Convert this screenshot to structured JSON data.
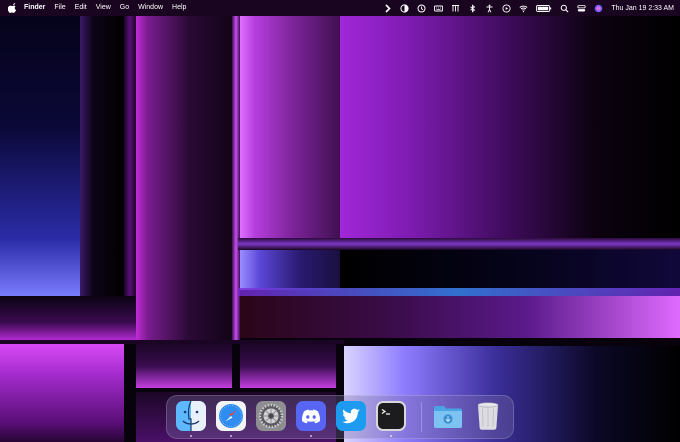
{
  "menubar": {
    "app_name": "Finder",
    "menus": [
      "File",
      "Edit",
      "View",
      "Go",
      "Window",
      "Help"
    ],
    "status_icons": [
      "chevron-right-icon",
      "contrast-icon",
      "time-machine-icon",
      "keyboard-icon",
      "display-icon",
      "bluetooth-icon",
      "accessibility-icon",
      "play-icon",
      "wifi-icon",
      "battery-icon",
      "search-icon",
      "control-center-icon",
      "siri-icon"
    ],
    "datetime": "Thu Jan 19  2:33 AM"
  },
  "dock": {
    "apps": [
      {
        "name": "Finder",
        "icon": "finder-icon",
        "running": true
      },
      {
        "name": "Safari",
        "icon": "safari-icon",
        "running": true
      },
      {
        "name": "System Settings",
        "icon": "settings-icon",
        "running": false
      },
      {
        "name": "Discord",
        "icon": "discord-icon",
        "running": true
      },
      {
        "name": "Twitter",
        "icon": "twitter-icon",
        "running": false
      },
      {
        "name": "Terminal",
        "icon": "terminal-icon",
        "running": true
      },
      {
        "name": "Downloads",
        "icon": "downloads-folder-icon",
        "running": false
      },
      {
        "name": "Trash",
        "icon": "trash-icon",
        "running": false
      }
    ]
  },
  "colors": {
    "accent_purple": "#b53ddd",
    "accent_blue": "#5b47d6",
    "dock_bg": "#786ea0"
  }
}
